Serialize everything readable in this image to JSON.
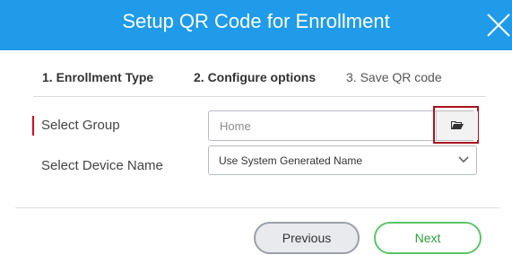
{
  "dialog": {
    "title": "Setup QR Code for Enrollment"
  },
  "steps": [
    {
      "label": "1. Enrollment Type"
    },
    {
      "label": "2. Configure options"
    },
    {
      "label": "3. Save QR code"
    }
  ],
  "form": {
    "group": {
      "label": "Select Group",
      "value": "Home",
      "required": true,
      "browse_icon": "folder-open-icon"
    },
    "device_name": {
      "label": "Select Device Name",
      "selected": "Use System Generated Name",
      "icon": "chevron-down-icon"
    }
  },
  "footer": {
    "previous_label": "Previous",
    "next_label": "Next"
  },
  "colors": {
    "header": "#1f9be9",
    "required_marker": "#d0021b",
    "highlight_border": "#a8131d",
    "next_accent": "#5cc46a"
  }
}
